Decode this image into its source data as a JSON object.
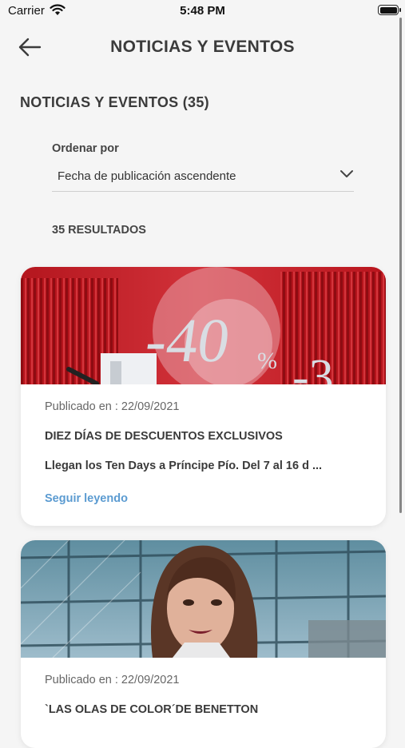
{
  "status_bar": {
    "carrier": "Carrier",
    "time": "5:48 PM"
  },
  "header": {
    "title": "NOTICIAS Y EVENTOS",
    "back_icon": "arrow-left-icon"
  },
  "section": {
    "title": "NOTICIAS Y EVENTOS (35)"
  },
  "sort": {
    "label": "Ordenar por",
    "selected": "Fecha de publicación ascendente"
  },
  "results": {
    "count_label": "35 RESULTADOS"
  },
  "cards": [
    {
      "published": "Publicado en : 22/09/2021",
      "title": "DIEZ DÍAS DE DESCUENTOS EXCLUSIVOS",
      "excerpt": "Llegan los Ten Days a Príncipe Pío.   Del 7 al 16 d ...",
      "read_more": "Seguir leyendo",
      "image_text": {
        "main": "-40",
        "percent": "%",
        "side": "-3"
      }
    },
    {
      "published": "Publicado en : 22/09/2021",
      "title": "`LAS OLAS DE COLOR´DE BENETTON"
    }
  ],
  "colors": {
    "link": "#5b9bd1",
    "promo_red": "#c8242b",
    "background": "#f5f5f5"
  }
}
